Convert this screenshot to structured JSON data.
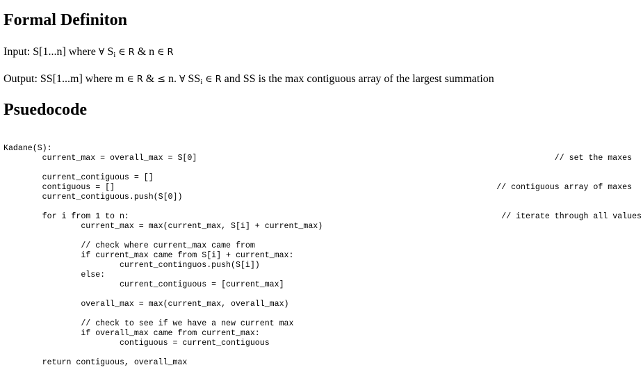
{
  "sections": {
    "formal": {
      "heading": "Formal Definiton",
      "input": {
        "label": "Input: S[1...n] where",
        "forall": "∀",
        "var": "S",
        "sub": "i",
        "elem": "∈",
        "set": "R",
        "amp": "&",
        "n": "n",
        "elem2": "∈",
        "set2": "R"
      },
      "output": {
        "label": "Output: SS[1...m] where m",
        "elem": "∈",
        "set": "R",
        "amp": "&",
        "leq": "≤",
        "n": "n.",
        "forall": "∀",
        "var": "SS",
        "sub": "i",
        "elem2": "∈",
        "set2": "R",
        "rest": "and SS is the max contiguous array of the largest summation"
      }
    },
    "pseudo": {
      "heading": "Psuedocode"
    }
  },
  "code_lines": [
    {
      "text": "Kadane(S):",
      "comment": ""
    },
    {
      "text": "        current_max = overall_max = S[0]",
      "comment": "// set the maxes  "
    },
    {
      "text": "",
      "comment": ""
    },
    {
      "text": "        current_contiguous = []",
      "comment": ""
    },
    {
      "text": "        contiguous = []",
      "comment": "// contiguous array of maxes  "
    },
    {
      "text": "        current_contiguous.push(S[0])",
      "comment": ""
    },
    {
      "text": "",
      "comment": ""
    },
    {
      "text": "        for i from 1 to n:",
      "comment": "// iterate through all values"
    },
    {
      "text": "                current_max = max(current_max, S[i] + current_max)",
      "comment": ""
    },
    {
      "text": "",
      "comment": ""
    },
    {
      "text": "                // check where current_max came from",
      "comment": ""
    },
    {
      "text": "                if current_max came from S[i] + current_max:",
      "comment": ""
    },
    {
      "text": "                        current_continguos.push(S[i])",
      "comment": ""
    },
    {
      "text": "                else:",
      "comment": ""
    },
    {
      "text": "                        current_contiguous = [current_max]",
      "comment": ""
    },
    {
      "text": "",
      "comment": ""
    },
    {
      "text": "                overall_max = max(current_max, overall_max)",
      "comment": ""
    },
    {
      "text": "",
      "comment": ""
    },
    {
      "text": "                // check to see if we have a new current max",
      "comment": ""
    },
    {
      "text": "                if overall_max came from current_max:",
      "comment": ""
    },
    {
      "text": "                        contiguous = current_contiguous",
      "comment": ""
    },
    {
      "text": "",
      "comment": ""
    },
    {
      "text": "        return contiguous, overall_max",
      "comment": ""
    }
  ]
}
